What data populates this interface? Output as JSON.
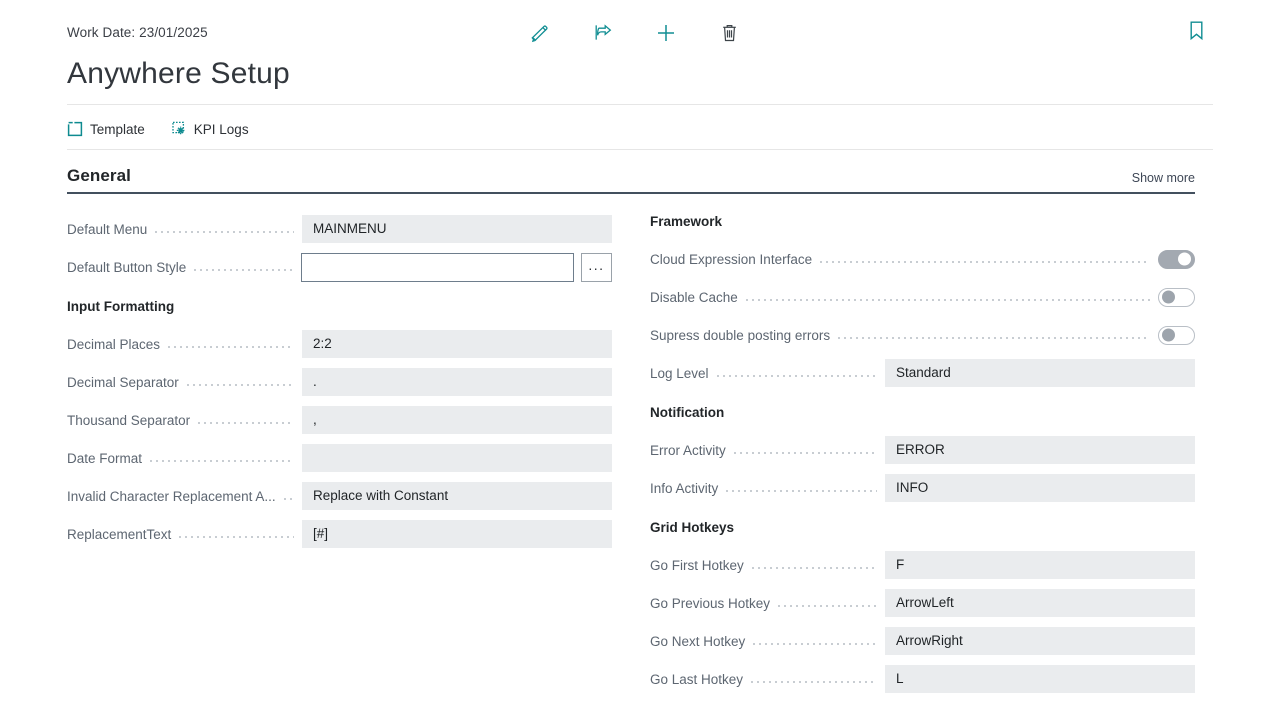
{
  "header": {
    "work_date_label": "Work Date: 23/01/2025",
    "title": "Anywhere Setup",
    "toolbar": [
      {
        "name": "edit-icon",
        "label": "Edit"
      },
      {
        "name": "share-icon",
        "label": "Share"
      },
      {
        "name": "new-icon",
        "label": "New"
      },
      {
        "name": "delete-icon",
        "label": "Delete"
      }
    ],
    "bookmark": {
      "name": "bookmark-icon",
      "label": "Bookmark"
    },
    "accent_color": "#118e93"
  },
  "tabs": [
    {
      "label": "Template",
      "icon": "template-icon"
    },
    {
      "label": "KPI Logs",
      "icon": "kpi-logs-icon"
    }
  ],
  "section": {
    "title": "General",
    "show_more": "Show more",
    "rule_color": "#43505e"
  },
  "left": {
    "fields": [
      {
        "label": "Default Menu",
        "value": "MAINMENU",
        "type": "readonly"
      },
      {
        "label": "Default Button Style",
        "value": "",
        "type": "input",
        "assist": "..."
      }
    ],
    "groups": [
      {
        "title": "Input Formatting",
        "fields": [
          {
            "label": "Decimal Places",
            "value": "2:2",
            "type": "readonly"
          },
          {
            "label": "Decimal Separator",
            "value": ".",
            "type": "readonly"
          },
          {
            "label": "Thousand Separator",
            "value": ",",
            "type": "readonly"
          },
          {
            "label": "Date Format",
            "value": "",
            "type": "readonly"
          },
          {
            "label": "Invalid Character Replacement A...",
            "value": "Replace with Constant",
            "type": "readonly"
          },
          {
            "label": "ReplacementText",
            "value": "[#]",
            "type": "readonly"
          }
        ]
      }
    ]
  },
  "right": {
    "groups": [
      {
        "title": "Framework",
        "fields": [
          {
            "label": "Cloud Expression Interface",
            "type": "toggle",
            "state": "on"
          },
          {
            "label": "Disable Cache",
            "type": "toggle",
            "state": "off"
          },
          {
            "label": "Supress double posting errors",
            "type": "toggle",
            "state": "off"
          },
          {
            "label": "Log Level",
            "value": "Standard",
            "type": "readonly"
          }
        ]
      },
      {
        "title": "Notification",
        "fields": [
          {
            "label": "Error Activity",
            "value": "ERROR",
            "type": "readonly"
          },
          {
            "label": "Info Activity",
            "value": "INFO",
            "type": "readonly"
          }
        ]
      },
      {
        "title": "Grid Hotkeys",
        "fields": [
          {
            "label": "Go First Hotkey",
            "value": "F",
            "type": "readonly"
          },
          {
            "label": "Go Previous Hotkey",
            "value": "ArrowLeft",
            "type": "readonly"
          },
          {
            "label": "Go Next Hotkey",
            "value": "ArrowRight",
            "type": "readonly"
          },
          {
            "label": "Go Last Hotkey",
            "value": "L",
            "type": "readonly"
          }
        ]
      }
    ]
  }
}
